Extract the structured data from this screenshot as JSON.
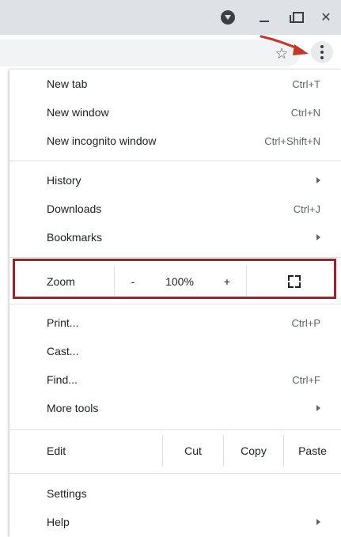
{
  "colors": {
    "highlight": "#a51e2c",
    "arrow": "#c0392b",
    "titlebar": "#dee1e6"
  },
  "titlebar": {
    "icons": [
      "profile-icon",
      "minimize-icon",
      "restore-icon",
      "close-icon"
    ],
    "close_glyph": "✕"
  },
  "toolbar": {
    "star_glyph": "☆",
    "star_icon": "bookmark-star-icon",
    "menu_icon": "more-vertical-icon"
  },
  "menu": {
    "group1": [
      {
        "label": "New tab",
        "accel": "Ctrl+T"
      },
      {
        "label": "New window",
        "accel": "Ctrl+N"
      },
      {
        "label": "New incognito window",
        "accel": "Ctrl+Shift+N"
      }
    ],
    "group2": [
      {
        "label": "History",
        "accel": ""
      },
      {
        "label": "Downloads",
        "accel": "Ctrl+J"
      },
      {
        "label": "Bookmarks",
        "accel": ""
      }
    ],
    "zoom": {
      "label": "Zoom",
      "minus": "-",
      "level": "100%",
      "plus": "+",
      "fullscreen_icon": "fullscreen-icon"
    },
    "group3": [
      {
        "label": "Print...",
        "accel": "Ctrl+P"
      },
      {
        "label": "Cast...",
        "accel": ""
      },
      {
        "label": "Find...",
        "accel": "Ctrl+F"
      },
      {
        "label": "More tools",
        "accel": ""
      }
    ],
    "edit": {
      "label": "Edit",
      "cut": "Cut",
      "copy": "Copy",
      "paste": "Paste"
    },
    "group4": [
      {
        "label": "Settings",
        "accel": ""
      },
      {
        "label": "Help",
        "accel": ""
      }
    ]
  }
}
